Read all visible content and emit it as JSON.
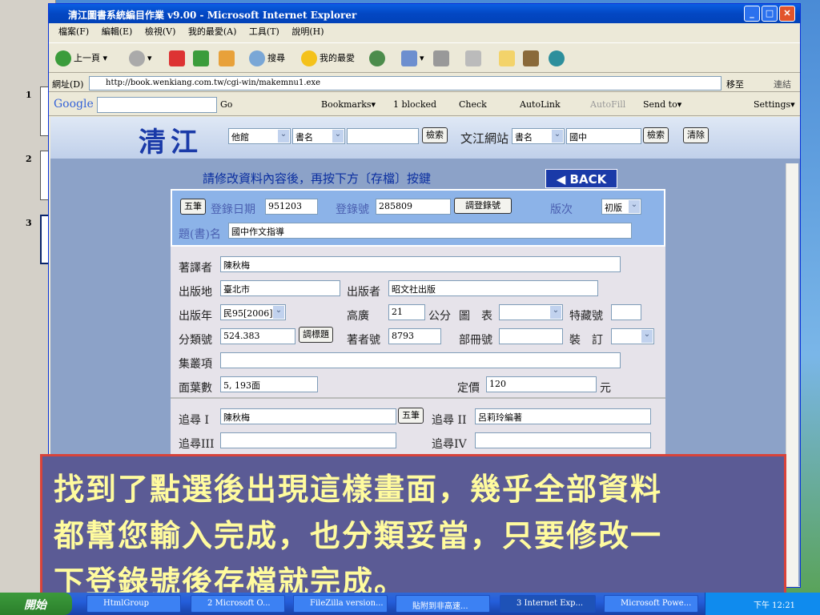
{
  "window": {
    "title": "清江圖書系統編目作業 v9.00 - Microsoft Internet Explorer"
  },
  "menu": [
    "檔案(F)",
    "編輯(E)",
    "檢視(V)",
    "我的最愛(A)",
    "工具(T)",
    "說明(H)"
  ],
  "toolbar": {
    "back": "上一頁",
    "search": "搜尋",
    "favorites": "我的最愛"
  },
  "address": {
    "label": "網址(D)",
    "url": "http://book.wenkiang.com.tw/cgi-win/makemnu1.exe",
    "go": "移至",
    "links": "連結"
  },
  "google_bar": {
    "brand": "Google",
    "go": "Go",
    "bookmarks": "Bookmarks▾",
    "blocked": "1 blocked",
    "check": "Check",
    "autolink": "AutoLink",
    "autofill": "AutoFill",
    "sendto": "Send to▾",
    "settings": "Settings▾"
  },
  "banner": {
    "logo": "清江",
    "select1": "他館",
    "select2": "書名",
    "search_btn": "檢索",
    "site_label": "文江網站",
    "select3": "書名",
    "keyword": "國中",
    "search_btn2": "檢索",
    "clear_btn": "清除"
  },
  "instruction": "請修改資料內容後，再按下方〔存檔〕按鍵",
  "back_btn": "◀ BACK",
  "form": {
    "five_btn": "五筆",
    "reg_date_label": "登錄日期",
    "reg_date": "951203",
    "reg_no_label": "登錄號",
    "reg_no": "285809",
    "adjust_reg_btn": "調登錄號",
    "edition_label": "版次",
    "edition": "初版",
    "title_label": "題(書)名",
    "title": "國中作文指導",
    "author_label": "著譯者",
    "author": "陳秋梅",
    "place_label": "出版地",
    "place": "臺北市",
    "publisher_label": "出版者",
    "publisher": "昭文社出版",
    "year_label": "出版年",
    "year": "民95[2006]",
    "width_label": "高廣",
    "width": "21",
    "unit_label": "公分",
    "figure_label": "圖　表",
    "special_label": "特藏號",
    "class_label": "分類號",
    "class_no": "524.383",
    "adjust_class_btn": "調標題",
    "author_no_label": "著者號",
    "author_no": "8793",
    "volume_label": "部冊號",
    "binding_label": "裝　訂",
    "series_label": "集叢項",
    "pages_label": "面葉數",
    "pages": "5, 193面",
    "price_label": "定價",
    "price": "120",
    "currency": "元",
    "trace1_label": "追尋 I",
    "trace1": "陳秋梅",
    "five_btn2": "五筆",
    "trace2_label": "追尋 II",
    "trace2": "呂莉玲編著",
    "trace3_label": "追尋III",
    "trace4_label": "追尋IV"
  },
  "caption": [
    "找到了點選後出現這樣畫面，幾乎全部資料",
    "都幫您輸入完成，也分類妥當，只要修改一",
    "下登錄號後存檔就完成。"
  ],
  "taskbar": {
    "start": "開始",
    "tasks": [
      "HtmlGroup",
      "2 Microsoft O...",
      "FileZilla version...",
      "貼附到非高速...",
      "3 Internet Exp...",
      "Microsoft Powe..."
    ],
    "clock": "下午 12:21"
  },
  "ppt": {
    "slides": [
      "1",
      "2",
      "3"
    ]
  }
}
